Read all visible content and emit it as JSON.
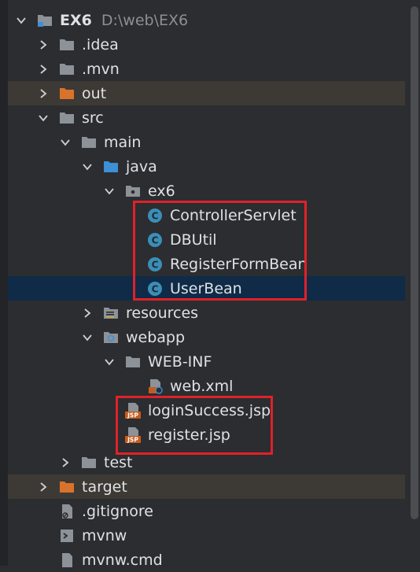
{
  "project": {
    "name": "EX6",
    "path": "D:\\web\\EX6"
  },
  "tree": [
    {
      "label": "EX6",
      "type": "project-root",
      "expanded": true
    },
    {
      "label": ".idea",
      "type": "folder",
      "expanded": false
    },
    {
      "label": ".mvn",
      "type": "folder",
      "expanded": false
    },
    {
      "label": "out",
      "type": "folder-excluded",
      "expanded": false
    },
    {
      "label": "src",
      "type": "folder",
      "expanded": true
    },
    {
      "label": "main",
      "type": "folder",
      "expanded": true
    },
    {
      "label": "java",
      "type": "source-folder",
      "expanded": true
    },
    {
      "label": "ex6",
      "type": "package",
      "expanded": true
    },
    {
      "label": "ControllerServlet",
      "type": "java-class"
    },
    {
      "label": "DBUtil",
      "type": "java-class"
    },
    {
      "label": "RegisterFormBean",
      "type": "java-class"
    },
    {
      "label": "UserBean",
      "type": "java-class",
      "selected": true
    },
    {
      "label": "resources",
      "type": "resources-folder",
      "expanded": false
    },
    {
      "label": "webapp",
      "type": "web-folder",
      "expanded": true
    },
    {
      "label": "WEB-INF",
      "type": "folder",
      "expanded": true
    },
    {
      "label": "web.xml",
      "type": "xml-file"
    },
    {
      "label": "loginSuccess.jsp",
      "type": "jsp-file"
    },
    {
      "label": "register.jsp",
      "type": "jsp-file"
    },
    {
      "label": "test",
      "type": "folder",
      "expanded": false
    },
    {
      "label": "target",
      "type": "folder-excluded",
      "expanded": false
    },
    {
      "label": ".gitignore",
      "type": "text-file"
    },
    {
      "label": "mvnw",
      "type": "script-file"
    },
    {
      "label": "mvnw.cmd",
      "type": "script-file"
    }
  ],
  "jsp_badge": "JSP",
  "colors": {
    "background": "#2b2d30",
    "selection": "#0f2b47",
    "excluded_row": "#3d3a35",
    "folder": "#8c9298",
    "excluded_folder": "#d9722b",
    "source_folder": "#3d8fd6",
    "class_icon": "#3b8eb8",
    "highlight_box": "#e0212a"
  }
}
